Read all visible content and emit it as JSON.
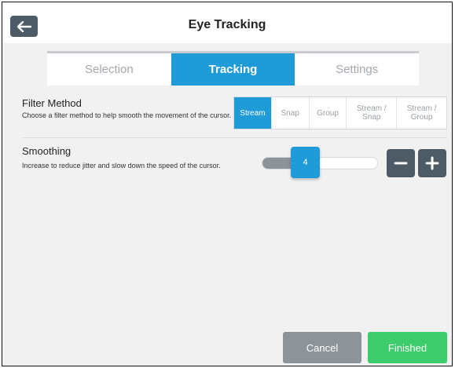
{
  "header": {
    "title": "Eye Tracking",
    "back_icon": "back-arrow-icon"
  },
  "tabs": [
    {
      "label": "Selection",
      "active": false
    },
    {
      "label": "Tracking",
      "active": true
    },
    {
      "label": "Settings",
      "active": false
    }
  ],
  "filter_method": {
    "label": "Filter Method",
    "description": "Choose a filter method to help smooth the movement of the cursor.",
    "options": [
      "Stream",
      "Snap",
      "Group",
      "Stream / Snap",
      "Stream / Group"
    ],
    "selected": "Stream"
  },
  "smoothing": {
    "label": "Smoothing",
    "description": "Increase to reduce jitter and slow down the speed of the cursor.",
    "value": "4",
    "fill_fraction": 0.3,
    "decrease_icon": "minus-icon",
    "increase_icon": "plus-icon"
  },
  "footer": {
    "cancel_label": "Cancel",
    "finished_label": "Finished"
  },
  "colors": {
    "accent": "#1f9bd8",
    "dark_button": "#4d5b66",
    "cancel": "#8c9399",
    "finished": "#3dcc6b"
  }
}
